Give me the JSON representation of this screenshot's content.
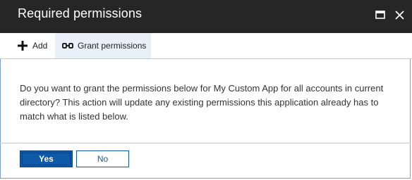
{
  "window": {
    "title": "Required permissions",
    "maximize_icon": "maximize-icon",
    "close_icon": "close-icon"
  },
  "toolbar": {
    "add_label": "Add",
    "add_icon": "plus-icon",
    "grant_label": "Grant permissions",
    "grant_icon": "link-icon"
  },
  "dialog": {
    "message": "Do you want to grant the permissions below for My Custom App for all accounts in current directory? This action will update any existing permissions this application already has to match what is listed below.",
    "yes_label": "Yes",
    "no_label": "No"
  },
  "colors": {
    "titlebar": "#262626",
    "accent": "#0f5aa8",
    "toolbar_highlight": "#e8f0f9",
    "panel_border": "#7aa1cc"
  }
}
